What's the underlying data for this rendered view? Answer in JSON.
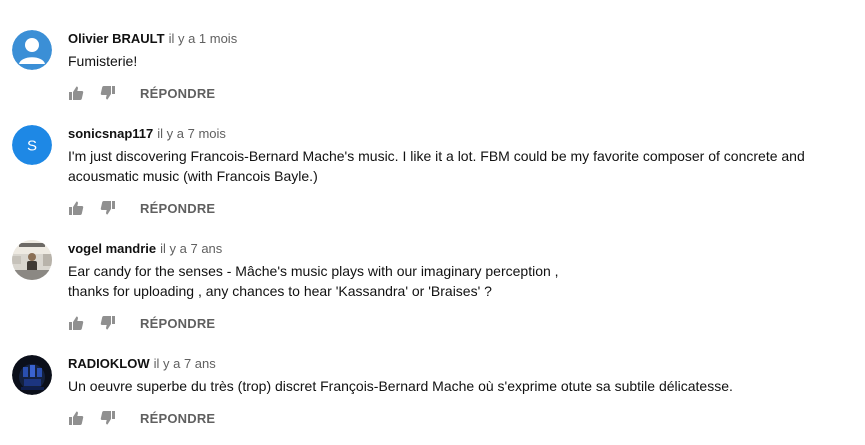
{
  "comments": [
    {
      "author": "Olivier BRAULT",
      "time": "il y a 1 mois",
      "text": "Fumisterie!",
      "reply_label": "RÉPONDRE",
      "avatar": {
        "type": "default-user",
        "bg": "#3b8fd6"
      }
    },
    {
      "author": "sonicsnap117",
      "time": "il y a 7 mois",
      "text": "I'm just discovering Francois-Bernard Mache's music. I like it a lot. FBM could be my favorite composer of concrete and\nacousmatic music (with Francois Bayle.)",
      "reply_label": "RÉPONDRE",
      "avatar": {
        "type": "letter",
        "letter": "S",
        "bg": "#1e88e5"
      }
    },
    {
      "author": "vogel mandrie",
      "time": "il y a 7 ans",
      "text": "Ear candy for the senses - Mâche's music plays with our imaginary perception ,\nthanks for uploading , any chances to hear 'Kassandra' or 'Braises' ?",
      "reply_label": "RÉPONDRE",
      "avatar": {
        "type": "photo"
      }
    },
    {
      "author": "RADIOKLOW",
      "time": "il y a 7 ans",
      "text": "Un oeuvre superbe du très (trop) discret François-Bernard Mache où s'exprime otute sa subtile délicatesse.",
      "reply_label": "RÉPONDRE",
      "avatar": {
        "type": "photo-dark"
      }
    }
  ],
  "colors": {
    "author": "#111111",
    "meta": "#606060",
    "icon": "#909090"
  }
}
